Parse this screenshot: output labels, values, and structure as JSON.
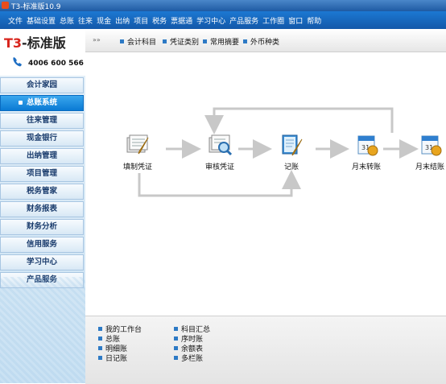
{
  "window": {
    "title": "T3-标准版10.9"
  },
  "menu": [
    "文件",
    "基础设置",
    "总账",
    "往来",
    "现金",
    "出纳",
    "项目",
    "税务",
    "票据通",
    "学习中心",
    "产品服务",
    "工作圈",
    "窗口",
    "帮助"
  ],
  "logo": {
    "brand_prefix": "T3",
    "brand_suffix": "-标准版",
    "phone": "4006 600 566"
  },
  "sidebar": {
    "items": [
      {
        "label": "会计家园"
      },
      {
        "label": "总账系统",
        "active": true
      },
      {
        "label": "往来管理"
      },
      {
        "label": "现金银行"
      },
      {
        "label": "出纳管理"
      },
      {
        "label": "项目管理"
      },
      {
        "label": "税务管家"
      },
      {
        "label": "财务报表"
      },
      {
        "label": "财务分析"
      },
      {
        "label": "信用服务"
      },
      {
        "label": "学习中心"
      },
      {
        "label": "产品服务"
      }
    ]
  },
  "tabs": [
    "会计科目",
    "凭证类别",
    "常用摘要",
    "外币种类"
  ],
  "flow": {
    "nodes": [
      {
        "label": "填制凭证",
        "icon": "voucher-entry-icon"
      },
      {
        "label": "审核凭证",
        "icon": "voucher-audit-icon"
      },
      {
        "label": "记账",
        "icon": "posting-icon"
      },
      {
        "label": "月末转账",
        "icon": "month-end-transfer-icon"
      },
      {
        "label": "月末结账",
        "icon": "month-end-close-icon"
      }
    ]
  },
  "quick_links": {
    "col1": [
      "我的工作台",
      "总账",
      "明细账",
      "日记账"
    ],
    "col2": [
      "科目汇总",
      "序时账",
      "余额表",
      "多栏账"
    ]
  },
  "colors": {
    "accent": "#1c78d2",
    "brand_red": "#d8241c",
    "active_nav": "#0a7ad4"
  }
}
